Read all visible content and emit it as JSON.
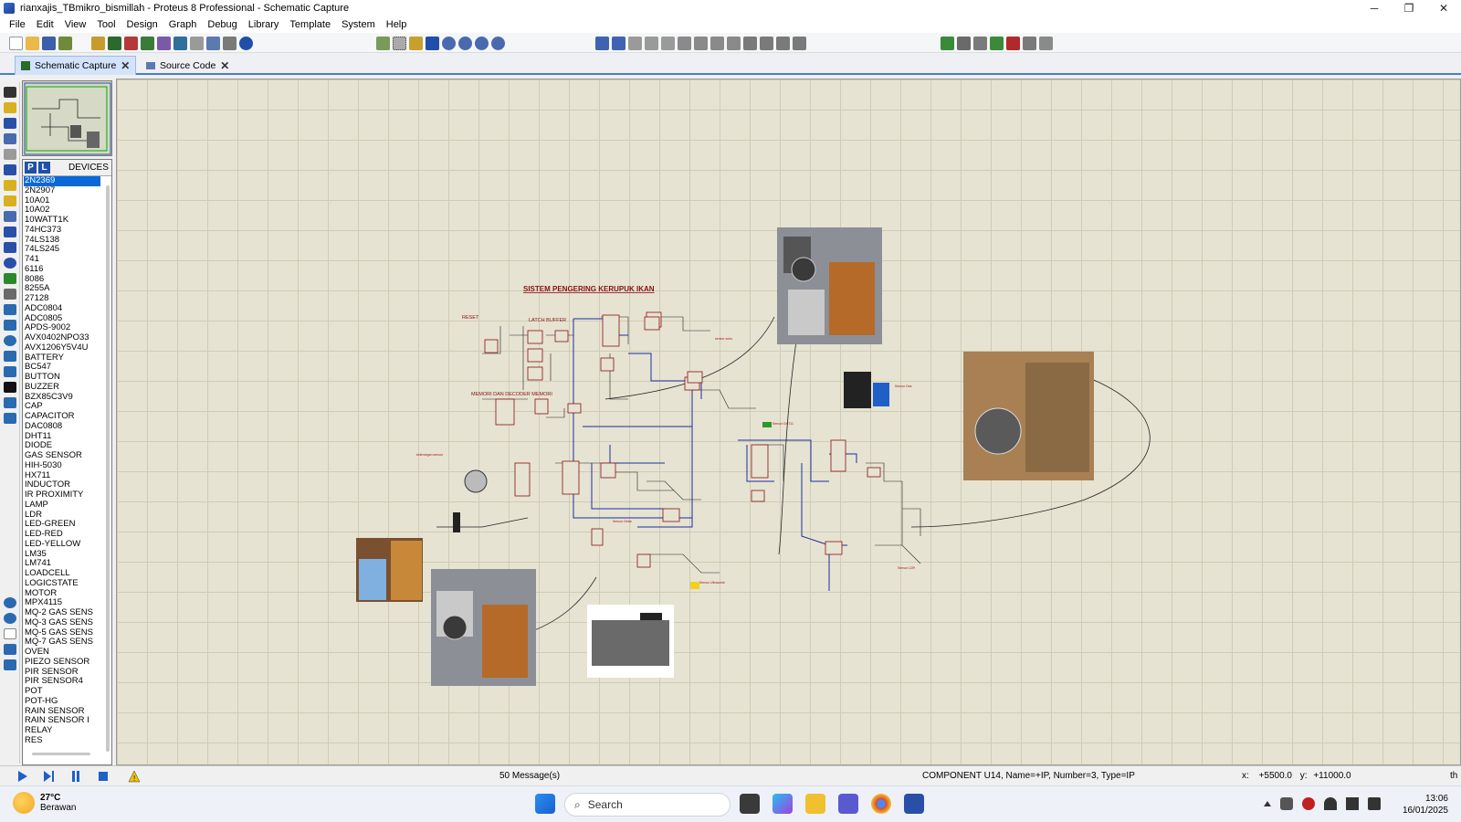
{
  "window": {
    "title": "rianxajis_TBmikro_bismillah - Proteus 8 Professional - Schematic Capture",
    "minimize": "─",
    "maximize": "❐",
    "close": "✕"
  },
  "menu": [
    "File",
    "Edit",
    "View",
    "Tool",
    "Design",
    "Graph",
    "Debug",
    "Library",
    "Template",
    "System",
    "Help"
  ],
  "tabs": [
    {
      "label": "Schematic Capture",
      "close": "✕"
    },
    {
      "label": "Source Code",
      "close": "✕"
    }
  ],
  "devices": {
    "title": "DEVICES",
    "p_label": "P",
    "l_label": "L",
    "selected": "2N2369",
    "items": [
      "2N2369",
      "2N2907",
      "10A01",
      "10A02",
      "10WATT1K",
      "74HC373",
      "74LS138",
      "74LS245",
      "741",
      "6116",
      "8086",
      "8255A",
      "27128",
      "ADC0804",
      "ADC0805",
      "APDS-9002",
      "AVX0402NPO33",
      "AVX1206Y5V4U",
      "BATTERY",
      "BC547",
      "BUTTON",
      "BUZZER",
      "BZX85C3V9",
      "CAP",
      "CAPACITOR",
      "DAC0808",
      "DHT11",
      "DIODE",
      "GAS SENSOR",
      "HIH-5030",
      "HX711",
      "INDUCTOR",
      "IR PROXIMITY",
      "LAMP",
      "LDR",
      "LED-GREEN",
      "LED-RED",
      "LED-YELLOW",
      "LM35",
      "LM741",
      "LOADCELL",
      "LOGICSTATE",
      "MOTOR",
      "MPX4115",
      "MQ-2 GAS SENS",
      "MQ-3 GAS SENS",
      "MQ-5 GAS SENS",
      "MQ-7 GAS SENS",
      "OVEN",
      "PIEZO SENSOR",
      "PIR SENSOR",
      "PIR SENSOR4",
      "POT",
      "POT-HG",
      "RAIN SENSOR",
      "RAIN SENSOR I",
      "RELAY",
      "RES"
    ]
  },
  "schematic": {
    "title": "SISTEM PENGERING KERUPUK IKAN",
    "labels": {
      "reset": "RESET",
      "latch": "LATCH BUFFER",
      "memory": "MEMORI DAN DECODER MEMORI"
    }
  },
  "status": {
    "messages": "50 Message(s)",
    "component": "COMPONENT U14, Name=+IP, Number=3, Type=IP",
    "coord_x_label": "x:",
    "coord_x": "+5500.0",
    "coord_y_label": "y:",
    "coord_y": "+11000.0",
    "unit": "th"
  },
  "taskbar": {
    "temperature": "27°C",
    "condition": "Berawan",
    "search_placeholder": "Search",
    "time": "13:06",
    "date": "16/01/2025"
  },
  "colors": {
    "accent": "#0a68d8",
    "wire_blue": "#1a2fa0",
    "component_red": "#8a1010",
    "canvas_bg": "#e6e3d2"
  }
}
